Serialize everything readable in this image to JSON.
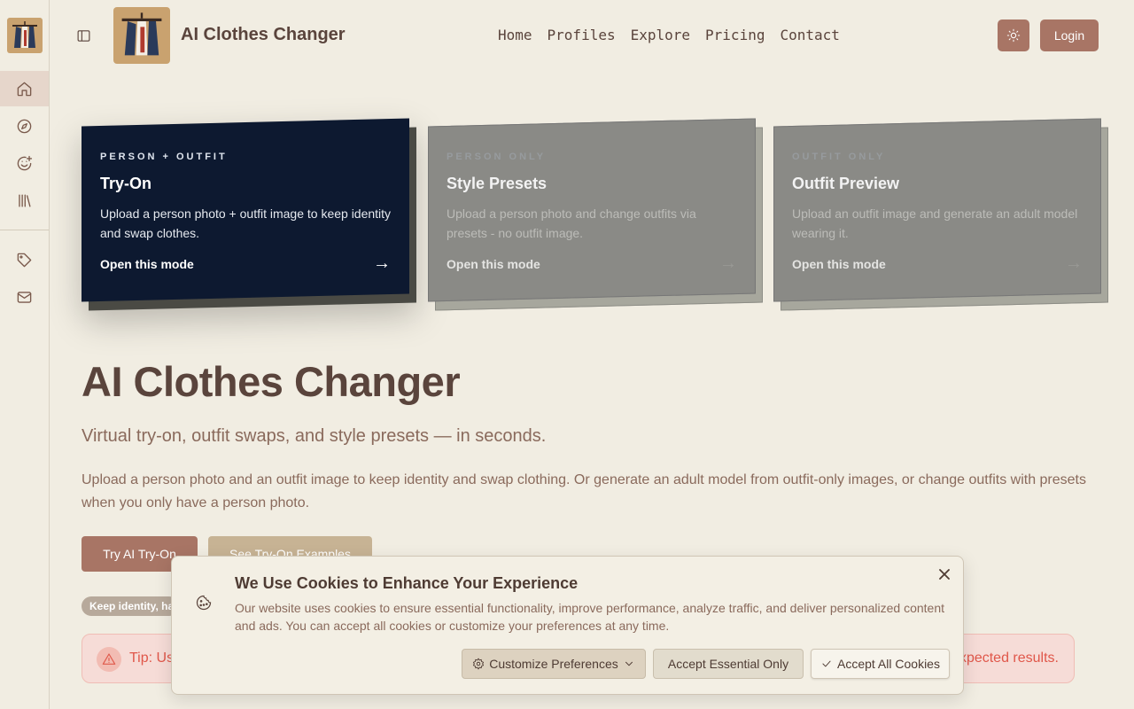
{
  "header": {
    "brand_name": "AI Clothes Changer",
    "nav": [
      "Home",
      "Profiles",
      "Explore",
      "Pricing",
      "Contact"
    ],
    "login_label": "Login"
  },
  "rail": {
    "items": [
      "home-icon",
      "compass-icon",
      "smile-plus-icon",
      "library-icon",
      "tag-icon",
      "mail-icon"
    ]
  },
  "modes": [
    {
      "kicker": "PERSON + OUTFIT",
      "title": "Try-On",
      "description": "Upload a person photo + outfit image to keep identity and swap clothes.",
      "cta": "Open this mode",
      "arrow": "→"
    },
    {
      "kicker": "PERSON ONLY",
      "title": "Style Presets",
      "description": "Upload a person photo and change outfits via presets - no outfit image.",
      "cta": "Open this mode",
      "arrow": "→"
    },
    {
      "kicker": "OUTFIT ONLY",
      "title": "Outfit Preview",
      "description": "Upload an outfit image and generate an adult model wearing it.",
      "cta": "Open this mode",
      "arrow": "→"
    }
  ],
  "hero": {
    "title": "AI Clothes Changer",
    "subtitle": "Virtual try-on, outfit swaps, and style presets — in seconds.",
    "description": "Upload a person photo and an outfit image to keep identity and swap clothing. Or generate an adult model from outfit-only images, or change outfits with presets when you only have a person photo.",
    "primary_button": "Try AI Try-On",
    "secondary_button": "See Try-On Examples",
    "pill": "Keep identity, hai"
  },
  "tip": {
    "text": "Tip: Us",
    "tail": "xpected results."
  },
  "cookie": {
    "title": "We Use Cookies to Enhance Your Experience",
    "text": "Our website uses cookies to ensure essential functionality, improve performance, analyze traffic, and deliver personalized content and ads. You can accept all cookies or customize your preferences at any time.",
    "customize_label": "Customize Preferences",
    "essential_label": "Accept Essential Only",
    "accept_all_label": "Accept All Cookies"
  },
  "colors": {
    "background": "#f1ede2",
    "accent": "#a87565",
    "active_card": "#0d1930",
    "tip_text": "#e0574a"
  }
}
